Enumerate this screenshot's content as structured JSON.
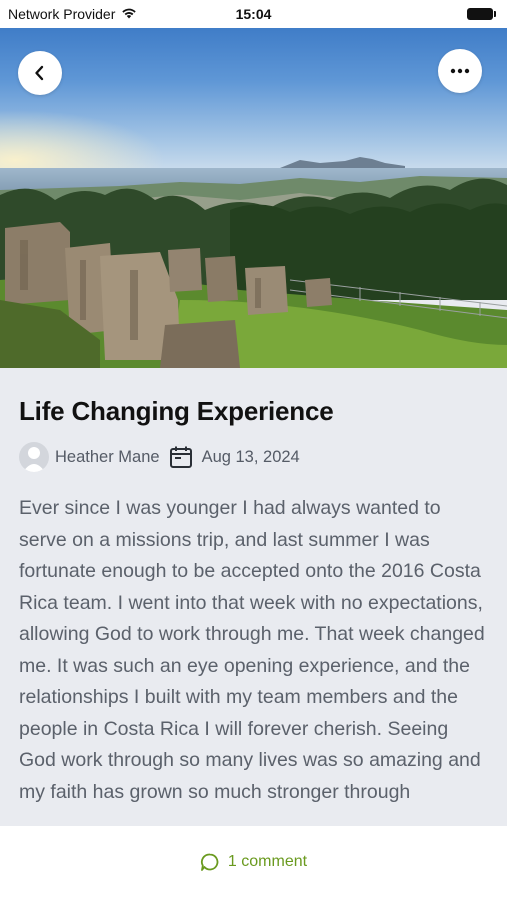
{
  "status_bar": {
    "carrier": "Network Provider",
    "time": "15:04"
  },
  "header": {
    "back_icon": "chevron-left-icon",
    "more_icon": "ellipsis-icon"
  },
  "post": {
    "title": "Life Changing Experience",
    "author": "Heather Mane",
    "date": "Aug 13, 2024",
    "body": "Ever since I was younger I had always wanted to serve on a missions trip, and last summer I was fortunate enough to be accepted onto the 2016 Costa Rica team. I went into that week with no expectations, allowing God to work through me. That week changed me. It was such an eye opening experience, and the relationships I built with my team members and the people in Costa Rica I will forever cherish. Seeing God work through so many lives was so amazing and my faith has grown so much stronger through"
  },
  "footer": {
    "comments_label": "1 comment",
    "accent_color": "#6a9a1f"
  }
}
